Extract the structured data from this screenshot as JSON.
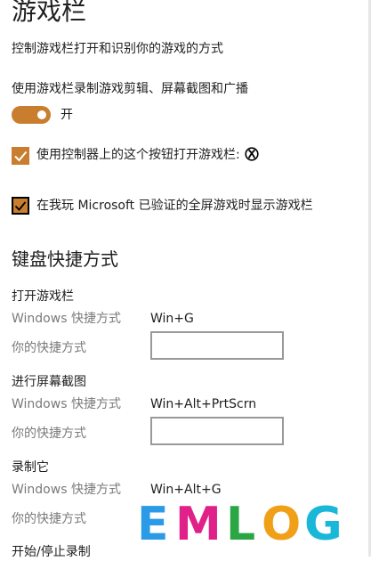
{
  "header": {
    "title": "游戏栏",
    "description": "控制游戏栏打开和识别你的游戏的方式"
  },
  "record_toggle": {
    "caption": "使用游戏栏录制游戏剪辑、屏幕截图和广播",
    "state_label": "开",
    "on": true
  },
  "checkboxes": [
    {
      "label": "使用控制器上的这个按钮打开游戏栏:",
      "checked": true
    },
    {
      "label": "在我玩 Microsoft 已验证的全屏游戏时显示游戏栏",
      "checked": true
    }
  ],
  "keyboard": {
    "section_title": "键盘快捷方式",
    "windows_label": "Windows 快捷方式",
    "yours_label": "你的快捷方式",
    "shortcuts": [
      {
        "title": "打开游戏栏",
        "windows": "Win+G",
        "custom": ""
      },
      {
        "title": "进行屏幕截图",
        "windows": "Win+Alt+PrtScrn",
        "custom": ""
      },
      {
        "title": "录制它",
        "windows": "Win+Alt+G",
        "custom": ""
      }
    ],
    "next_title": "开始/停止录制"
  },
  "watermark": {
    "letters": [
      "E",
      "M",
      "L",
      "O",
      "G"
    ],
    "colors": [
      "#2b9be8",
      "#e0218a",
      "#2aa744",
      "#f0a018",
      "#19b8d8"
    ]
  },
  "colors": {
    "accent": "#c97d2e",
    "muted_text": "#7a7a7a"
  }
}
